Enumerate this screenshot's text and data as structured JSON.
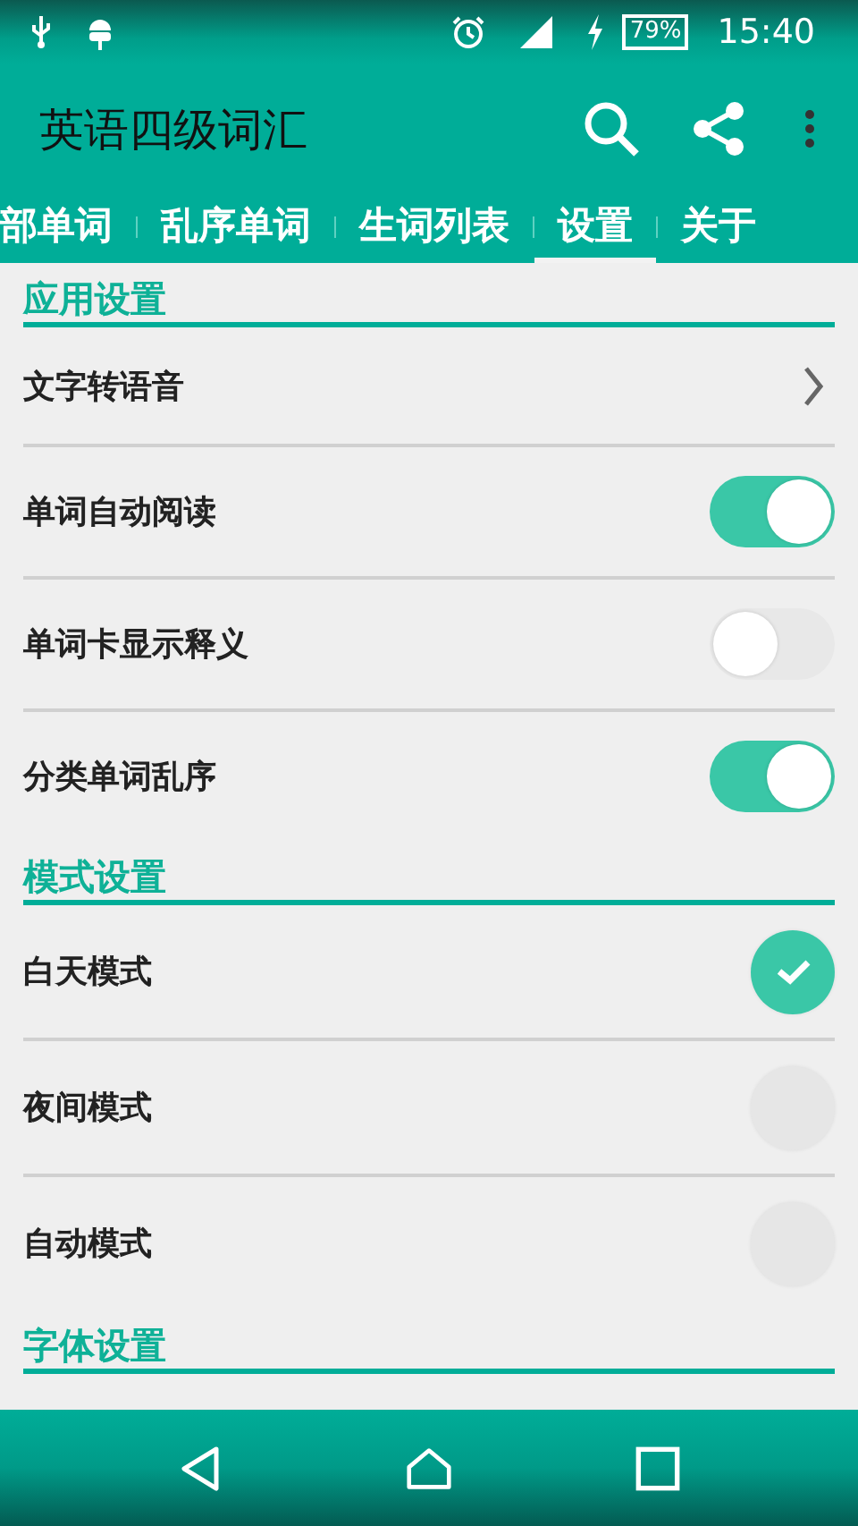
{
  "status_bar": {
    "battery": "79%",
    "time": "15:40"
  },
  "app_bar": {
    "title": "英语四级词汇"
  },
  "tabs": [
    {
      "label": "部单词",
      "selected": false
    },
    {
      "label": "乱序单词",
      "selected": false
    },
    {
      "label": "生词列表",
      "selected": false
    },
    {
      "label": "设置",
      "selected": true
    },
    {
      "label": "关于",
      "selected": false
    }
  ],
  "sections": [
    {
      "title": "应用设置",
      "items": [
        {
          "kind": "link",
          "label": "文字转语音"
        },
        {
          "kind": "switch",
          "label": "单词自动阅读",
          "on": true
        },
        {
          "kind": "switch",
          "label": "单词卡显示释义",
          "on": false
        },
        {
          "kind": "switch",
          "label": "分类单词乱序",
          "on": true
        }
      ]
    },
    {
      "title": "模式设置",
      "items": [
        {
          "kind": "radio",
          "label": "白天模式",
          "selected": true
        },
        {
          "kind": "radio",
          "label": "夜间模式",
          "selected": false
        },
        {
          "kind": "radio",
          "label": "自动模式",
          "selected": false
        }
      ]
    },
    {
      "title": "字体设置"
    }
  ]
}
